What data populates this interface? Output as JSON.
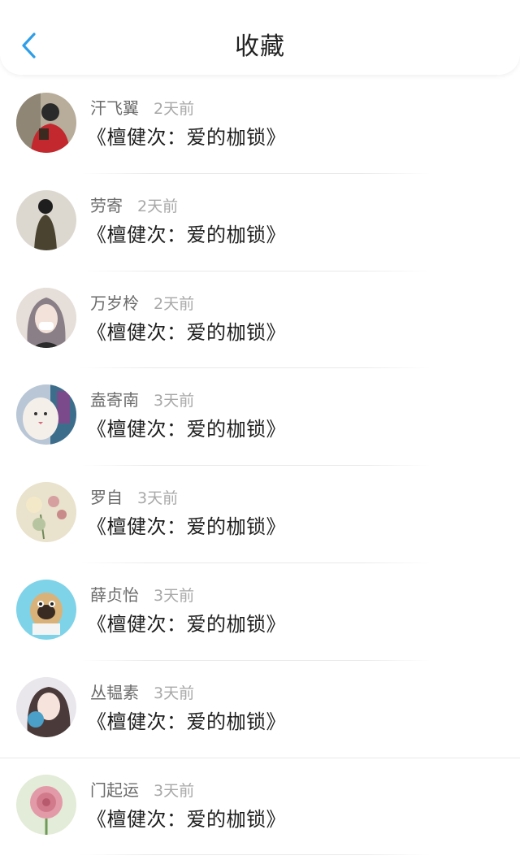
{
  "header": {
    "title": "收藏",
    "back_icon": "chevron-left-icon",
    "accent": "#2f9ee8"
  },
  "items": [
    {
      "name": "汗飞翼",
      "time": "2天前",
      "title": "《檀健次：爱的枷锁》"
    },
    {
      "name": "劳寄",
      "time": "2天前",
      "title": "《檀健次：爱的枷锁》"
    },
    {
      "name": "万岁柃",
      "time": "2天前",
      "title": "《檀健次：爱的枷锁》"
    },
    {
      "name": "盍寄南",
      "time": "3天前",
      "title": "《檀健次：爱的枷锁》"
    },
    {
      "name": "罗自",
      "time": "3天前",
      "title": "《檀健次：爱的枷锁》"
    },
    {
      "name": "薛贞怡",
      "time": "3天前",
      "title": "《檀健次：爱的枷锁》"
    },
    {
      "name": "丛韫素",
      "time": "3天前",
      "title": "《檀健次：爱的枷锁》"
    },
    {
      "name": "门起运",
      "time": "3天前",
      "title": "《檀健次：爱的枷锁》"
    }
  ]
}
